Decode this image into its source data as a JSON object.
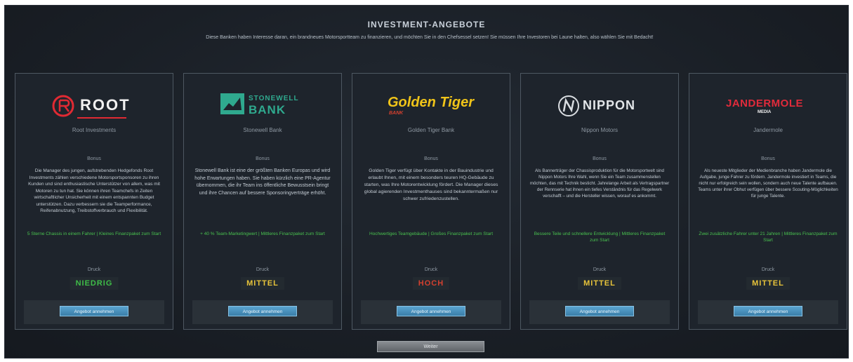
{
  "header": {
    "title": "INVESTMENT-ANGEBOTE",
    "subtitle": "Diese Banken haben Interesse daran, ein brandneues Motorsportteam zu finanzieren, und möchten Sie in den Chefsessel setzen! Sie müssen Ihre Investoren bei Laune halten, also wählen Sie mit Bedacht!"
  },
  "labels": {
    "bonus": "Bonus",
    "risk": "Druck"
  },
  "offers": [
    {
      "logo_text": "ROOT",
      "name": "Root Investments",
      "description": "Die Manager des jungen, aufstrebenden Hedgefonds Root Investments zählen verschiedene Motorsportsponsoren zu ihren Kunden und sind enthusiastische Unterstützer von allem, was mit Motoren zu tun hat. Sie können ihren Teamchefs in Zeiten wirtschaftlicher Unsicherheit mit einem entspannten Budget unterstützen. Dazu verbessern sie die Teamperformance, Reifenabnutzung, Treibstoffverbrauch und Flexibilität.",
      "bonus": "5 Sterne Chassis in einem Fahrer | Kleines Finanzpaket zum Start",
      "risk": "NIEDRIG",
      "risk_color": "#3fbe48",
      "button": "Angebot annehmen"
    },
    {
      "logo_text_top": "STONEWELL",
      "logo_text_bottom": "BANK",
      "name": "Stonewell Bank",
      "description": "Stonewell Bank ist eine der größten Banken Europas und wird hohe Erwartungen haben. Sie haben kürzlich eine PR-Agentur übernommen, die ihr Team ins öffentliche Bewusstsein bringt und ihre Chancen auf bessere Sponsoringverträge erhöht.",
      "bonus": "+ 40 % Team-Marketingwert | Mittleres Finanzpaket zum Start",
      "risk": "MITTEL",
      "risk_color": "#e8c43a",
      "button": "Angebot annehmen"
    },
    {
      "logo_text_top": "Golden Tiger",
      "logo_text_bottom": "BANK",
      "name": "Golden Tiger Bank",
      "description": "Golden Tiger verfügt über Kontakte in der Bauindustrie und erlaubt Ihnen, mit einem besonders teuren HQ-Gebäude zu starten, was Ihre Motorentwicklung fördert. Die Manager dieses global agierenden Investmenthauses sind bekanntermaßen nur schwer zufriedenzustellen.",
      "bonus": "Hochwertiges Teamgebäude | Großes Finanzpaket zum Start",
      "risk": "HOCH",
      "risk_color": "#d3402f",
      "button": "Angebot annehmen"
    },
    {
      "logo_text": "NIPPON",
      "name": "Nippon Motors",
      "description": "Als Bannerträger der Chassisproduktion für die Motorsportwelt sind Nippon Motors Ihre Wahl, wenn Sie ein Team zusammenstellen möchten, das mit Technik besticht. Jahrelange Arbeit als Vertragspartner der Rennserie hat ihnen ein tiefes Verständnis für das Regelwerk verschafft – und die Hersteller wissen, worauf es ankommt.",
      "bonus": "Bessere Teile und schnellere Entwicklung | Mittleres Finanzpaket zum Start",
      "risk": "MITTEL",
      "risk_color": "#e8c43a",
      "button": "Angebot annehmen"
    },
    {
      "logo_text_top": "JANDERMOLE",
      "logo_text_bottom": "MEDIA",
      "name": "Jandermole",
      "description": "Als neueste Mitglieder der Medienbranche haben Jandermole die Aufgabe, junge Fahrer zu fördern. Jandermole investiert in Teams, die nicht nur erfolgreich sein wollen, sondern auch neue Talente aufbauen. Teams unter ihrer Obhut verfügen über bessere Scouting-Möglichkeiten für junge Talente.",
      "bonus": "Zwei zusätzliche Fahrer unter 21 Jahren | Mittleres Finanzpaket zum Start",
      "risk": "MITTEL",
      "risk_color": "#e8c43a",
      "button": "Angebot annehmen"
    }
  ],
  "footer": {
    "continue": "Weiter"
  },
  "colors": {
    "root_red": "#e02a33",
    "stonewell_teal": "#2fa98e",
    "golden_tiger_gold": "#f0c419",
    "golden_tiger_red": "#d3402f",
    "jandermole_red": "#e12b3b",
    "accept_blue": "#4a93bf",
    "bonus_green": "#49c24f"
  }
}
